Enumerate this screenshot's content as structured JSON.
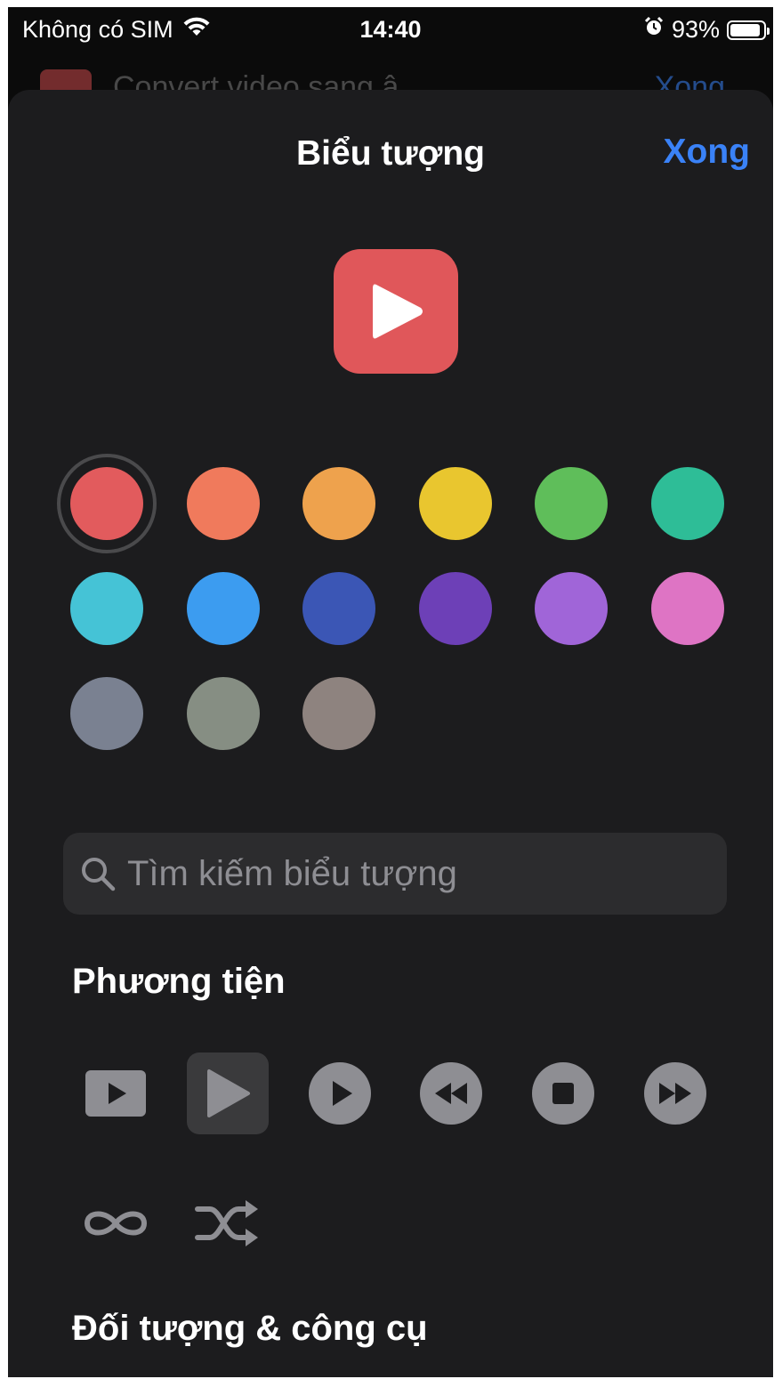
{
  "status_bar": {
    "carrier": "Không có SIM",
    "time": "14:40",
    "battery_percent": "93%",
    "battery_level": 0.93
  },
  "behind": {
    "title": "Convert video sang â",
    "done_label": "Xong"
  },
  "sheet": {
    "title": "Biểu tượng",
    "done_label": "Xong"
  },
  "preview": {
    "color": "#e0575a",
    "glyph": "play-icon"
  },
  "colors": [
    {
      "name": "red",
      "hex": "#e25b5d",
      "selected": true
    },
    {
      "name": "orange",
      "hex": "#f07a5c",
      "selected": false
    },
    {
      "name": "amber",
      "hex": "#eea24d",
      "selected": false
    },
    {
      "name": "yellow",
      "hex": "#e9c62f",
      "selected": false
    },
    {
      "name": "green",
      "hex": "#5fbe5a",
      "selected": false
    },
    {
      "name": "teal",
      "hex": "#2ebd97",
      "selected": false
    },
    {
      "name": "cyan",
      "hex": "#45c3d6",
      "selected": false
    },
    {
      "name": "blue",
      "hex": "#3c9cf0",
      "selected": false
    },
    {
      "name": "indigo",
      "hex": "#3b56b5",
      "selected": false
    },
    {
      "name": "purple",
      "hex": "#6d40b7",
      "selected": false
    },
    {
      "name": "violet",
      "hex": "#a065d8",
      "selected": false
    },
    {
      "name": "pink",
      "hex": "#de74c4",
      "selected": false
    },
    {
      "name": "slate",
      "hex": "#7a8191",
      "selected": false
    },
    {
      "name": "sage",
      "hex": "#868e83",
      "selected": false
    },
    {
      "name": "taupe",
      "hex": "#8e837f",
      "selected": false
    }
  ],
  "search": {
    "placeholder": "Tìm kiếm biểu tượng",
    "value": ""
  },
  "sections": [
    {
      "title": "Phương tiện",
      "icons": [
        "play-rectangle-icon",
        "play-icon",
        "play-circle-icon",
        "backward-circle-icon",
        "stop-circle-icon",
        "forward-circle-icon",
        "infinity-icon",
        "shuffle-icon"
      ],
      "selected_index": 1
    },
    {
      "title": "Đối tượng & công cụ"
    }
  ]
}
